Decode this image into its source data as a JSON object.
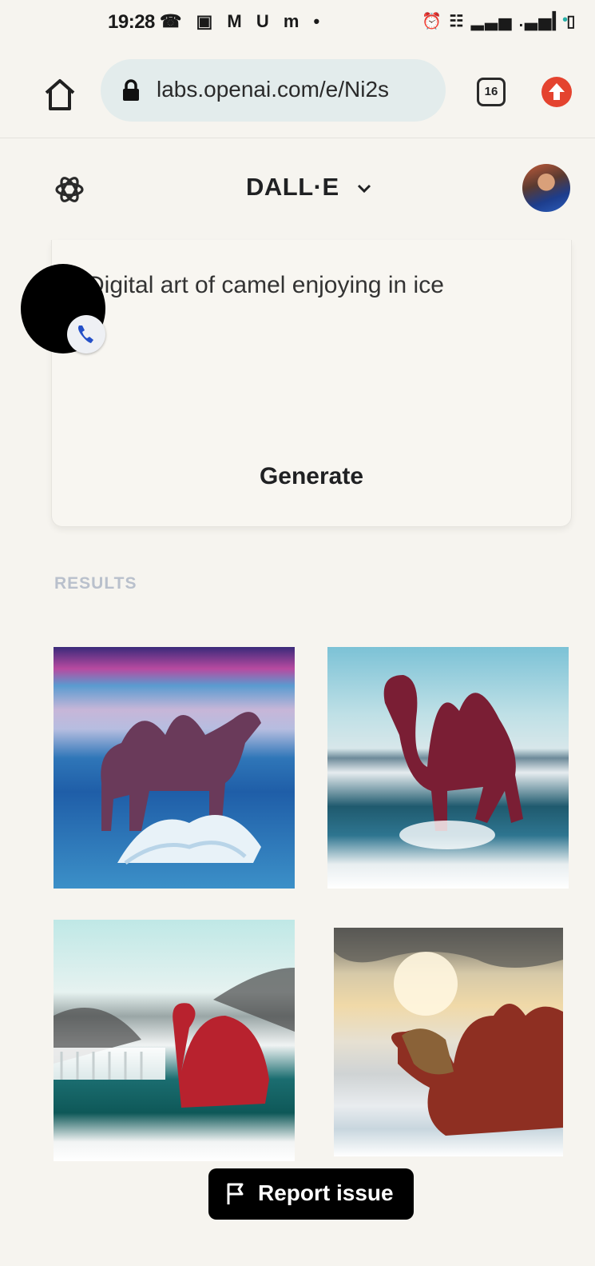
{
  "status_bar": {
    "time": "19:28",
    "left_icons": "☎ ▣ M U m •",
    "right_icons": "⏰ ☷ ▂▃▅ .▃▅▎▯"
  },
  "browser": {
    "url": "labs.openai.com/e/Ni2s",
    "tab_count": "16"
  },
  "app": {
    "title": "DALL·E"
  },
  "prompt": {
    "text": "Digital art of camel enjoying in ice",
    "generate_label": "Generate"
  },
  "results": {
    "label": "RESULTS",
    "images": [
      {
        "icon": "camel-image-1"
      },
      {
        "icon": "camel-image-2"
      },
      {
        "icon": "camel-image-3"
      },
      {
        "icon": "camel-image-4"
      }
    ]
  },
  "report": {
    "label": "Report issue"
  },
  "colors": {
    "background": "#f6f4ef",
    "url_bar": "#e3ecec",
    "extension": "#e4432f",
    "results_label": "#b9c0cc"
  }
}
